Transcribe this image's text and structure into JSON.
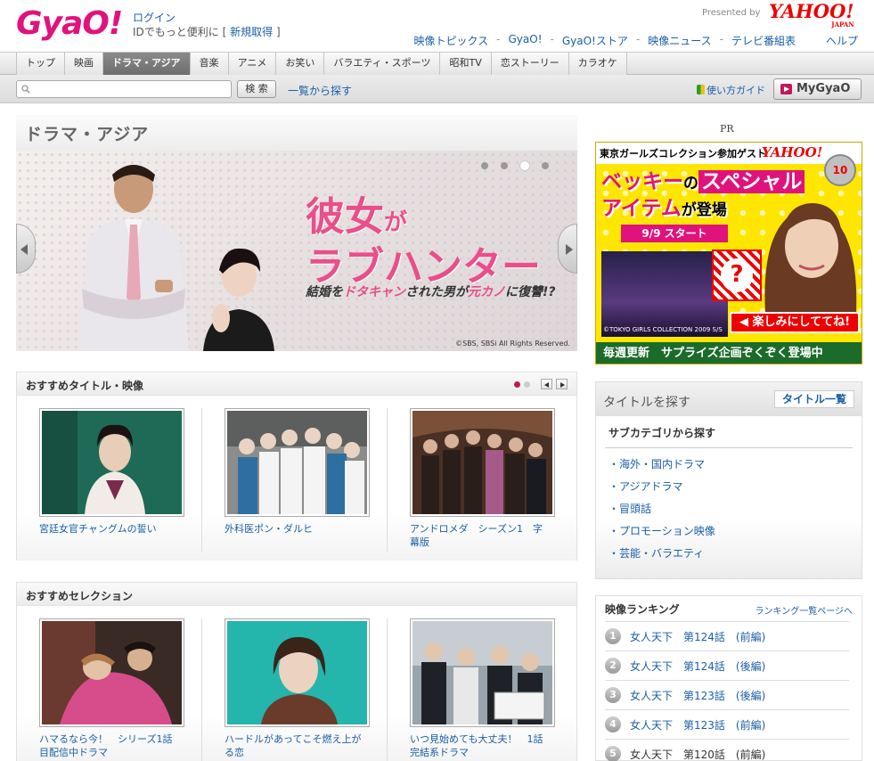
{
  "header": {
    "logo": "GyaO!",
    "login": "ログイン",
    "login_sub": "IDでもっと便利に [",
    "signup": "新規取得",
    "login_sub_end": "]",
    "presented_by": "Presented by",
    "yahoo": "YAHOO!",
    "yahoo_japan": "JAPAN",
    "links": [
      "映像トピックス",
      "GyaO!",
      "GyaO!ストア",
      "映像ニュース",
      "テレビ番組表"
    ],
    "help": "ヘルプ"
  },
  "nav": {
    "tabs": [
      "トップ",
      "映画",
      "ドラマ・アジア",
      "音楽",
      "アニメ",
      "お笑い",
      "バラエティ・スポーツ",
      "昭和TV",
      "恋ストーリー",
      "カラオケ"
    ],
    "active_index": 2
  },
  "search": {
    "placeholder": "",
    "button": "検 索",
    "list_link": "一覧から探す",
    "guide": "使い方ガイド",
    "mygyao": "MyGyaO"
  },
  "page_title": "ドラマ・アジア",
  "banner": {
    "title_line1_a": "彼女",
    "title_line1_b": "が",
    "title_line2": "ラブハンター",
    "subtitle_a": "結婚を",
    "subtitle_hl1": "ドタキャン",
    "subtitle_b": "された男が",
    "subtitle_hl2": "元カノ",
    "subtitle_c": "に復讐!?",
    "copyright": "©SBS, SBSi All Rights Reserved.",
    "dot_count": 4,
    "active_dot": 2
  },
  "recommend_titles": {
    "heading": "おすすめタイトル・映像",
    "items": [
      {
        "caption": "宮廷女官チャングムの誓い"
      },
      {
        "caption": "外科医ポン・ダルヒ"
      },
      {
        "caption": "アンドロメダ　シーズン1　字幕版"
      }
    ]
  },
  "recommend_selection": {
    "heading": "おすすめセレクション",
    "items": [
      {
        "caption": "ハマるなら今！　シリーズ1話目配信中ドラマ"
      },
      {
        "caption": "ハードルがあってこそ燃え上がる恋"
      },
      {
        "caption": "いつ見始めても大丈夫！　1話完結系ドラマ"
      }
    ]
  },
  "ad": {
    "pr": "PR",
    "top_text": "東京ガールズコレクション参加ゲスト",
    "yahoo": "YAHOO!",
    "badge": "10",
    "headline_a": "ベッキー",
    "headline_b": "の",
    "headline_c": "スペシャル",
    "headline_d": "アイテム",
    "headline_e": "が登場",
    "date": "9/9 スタート",
    "photo_caption": "©TOKYO GIRLS COLLECTION 2009 S/S",
    "enjoy": "◀ 楽しみにしててね!",
    "bottom": "毎週更新　サプライズ企画ぞくぞく登場中"
  },
  "find": {
    "heading": "タイトルを探す",
    "button": "タイトル一覧",
    "sub_heading": "サブカテゴリから探す",
    "items": [
      "海外・国内ドラマ",
      "アジアドラマ",
      "冒頭話",
      "プロモーション映像",
      "芸能・バラエティ"
    ]
  },
  "ranking": {
    "heading": "映像ランキング",
    "more": "ランキング一覧ページへ",
    "items": [
      {
        "num": "1",
        "title": "女人天下　第124話　(前編)"
      },
      {
        "num": "2",
        "title": "女人天下　第124話　(後編)"
      },
      {
        "num": "3",
        "title": "女人天下　第123話　(後編)"
      },
      {
        "num": "4",
        "title": "女人天下　第123話　(前編)"
      },
      {
        "num": "5",
        "title": "女人天下　第120話　(前編)"
      }
    ]
  }
}
